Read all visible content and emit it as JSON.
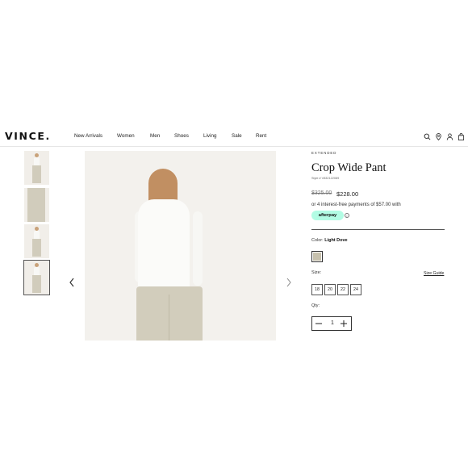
{
  "header": {
    "logo": "VINCE.",
    "nav": [
      "New Arrivals",
      "Women",
      "Men",
      "Shoes",
      "Living",
      "Sale",
      "Rent"
    ],
    "icons": [
      "search-icon",
      "location-pin-icon",
      "account-icon",
      "bag-icon"
    ]
  },
  "gallery": {
    "thumbnails": [
      "thumb-front",
      "thumb-closeup",
      "thumb-side",
      "thumb-back"
    ],
    "active_index": 3,
    "prev_icon": "chevron-left-icon",
    "next_icon": "chevron-right-icon"
  },
  "product": {
    "eyebrow": "EXTENDED",
    "title": "Crop Wide Pant",
    "style_number": "Style # V832122089",
    "price_original": "$325.00",
    "price_sale": "$228.00",
    "installments": "or 4 interest-free payments of $57.00 with",
    "afterpay": "afterpay",
    "color_label": "Color:",
    "color_value": "Light Dove",
    "swatch_color": "#c7c1ad",
    "size_label": "Size:",
    "size_guide": "Size Guide",
    "sizes": [
      "18",
      "20",
      "22",
      "24"
    ],
    "qty_label": "Qty:",
    "qty_value": "1"
  }
}
